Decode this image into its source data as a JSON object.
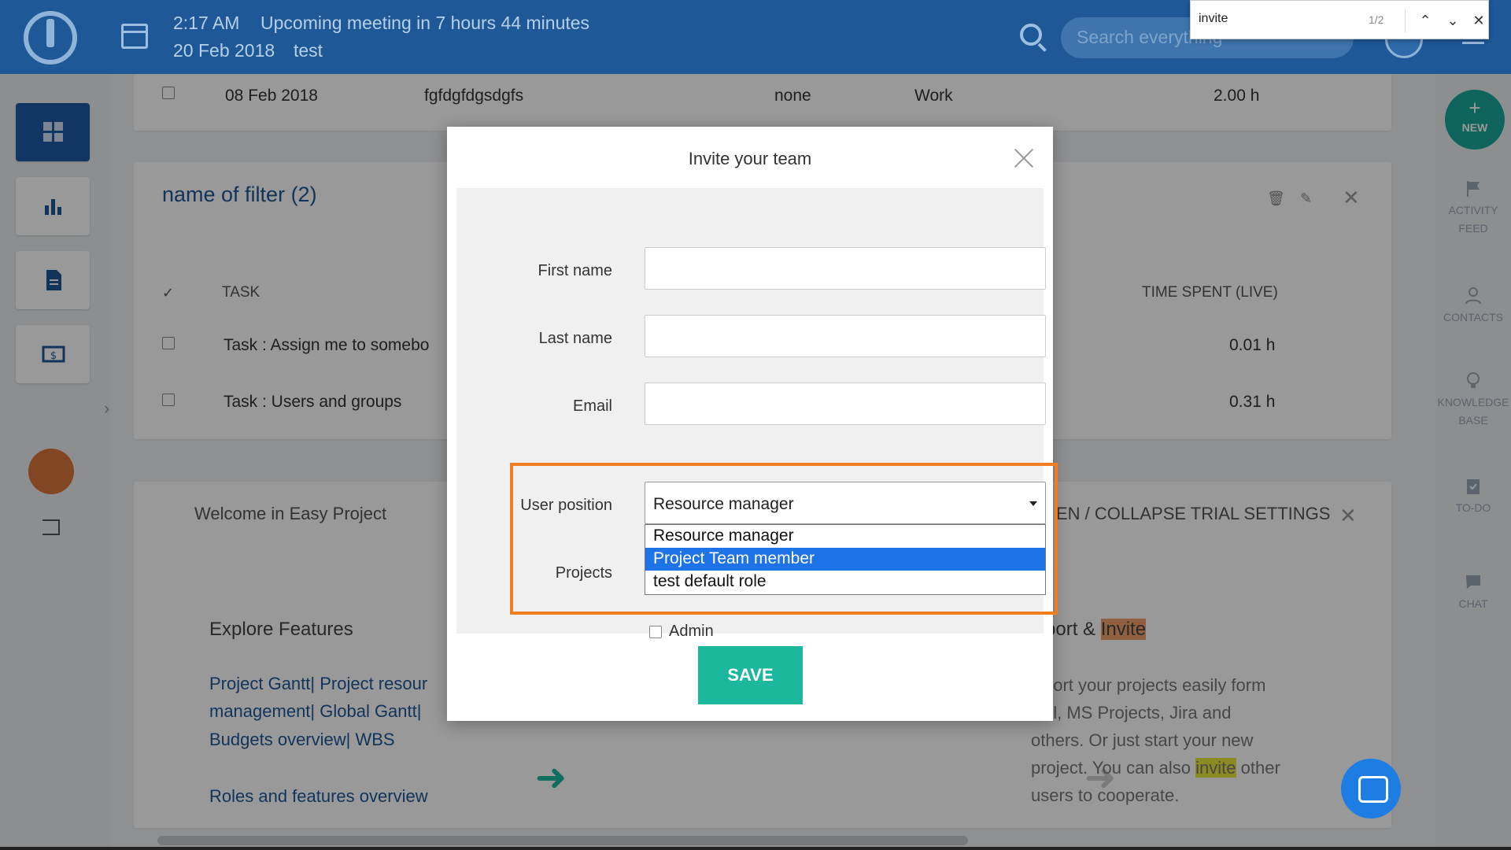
{
  "topbar": {
    "time": "2:17 AM",
    "upcoming": "Upcoming meeting in 7 hours 44 minutes",
    "date": "20 Feb 2018",
    "meeting_name": "test",
    "search_placeholder": "Search everything"
  },
  "findbar": {
    "query": "invite",
    "count": "1/2",
    "prev": "⌃",
    "next": "⌄",
    "close": "✕"
  },
  "background": {
    "top_row": {
      "date": "08 Feb 2018",
      "subject": "fgfdgfdgsdgfs",
      "status": "none",
      "activity": "Work",
      "hours": "2.00 h"
    },
    "filter_title": "name of filter (2)",
    "table_header_task": "TASK",
    "table_header_time": "TIME SPENT (LIVE)",
    "rows": [
      {
        "task": "Task : Assign me to somebo",
        "hours": "0.01 h"
      },
      {
        "task": "Task : Users and groups",
        "hours": "0.31 h"
      }
    ],
    "welcome": "Welcome in Easy Project",
    "trial_settings": "EN / COLLAPSE TRIAL SETTINGS",
    "explore_title": "Explore Features",
    "explore_links": "Project Gantt| Project resour",
    "explore_links2": "management| Global Gantt|",
    "explore_links3": "Budgets overview| WBS",
    "roles_link": "Roles and features overview",
    "import_title_pre": "port & ",
    "import_title_hl": "Invite",
    "import_text1": "port your projects easily form",
    "import_text2": "el, MS Projects, Jira and",
    "import_text3": "others. Or just start your new",
    "import_text4_pre": "project. You can also ",
    "import_text4_hl": "invite",
    "import_text4_post": " other",
    "import_text5": "users to cooperate."
  },
  "rightbar": {
    "new": "NEW",
    "activity_feed_1": "ACTIVITY",
    "activity_feed_2": "FEED",
    "contacts": "CONTACTS",
    "kb_1": "KNOWLEDGE",
    "kb_2": "BASE",
    "todo": "TO-DO",
    "chat": "CHAT"
  },
  "modal": {
    "title": "Invite your team",
    "first_name_label": "First name",
    "last_name_label": "Last name",
    "email_label": "Email",
    "user_position_label": "User position",
    "projects_label": "Projects",
    "user_position_value": "Resource manager",
    "options": [
      "Resource manager",
      "Project Team member",
      "test default role"
    ],
    "admin_label": "Admin",
    "save_label": "SAVE"
  },
  "colors": {
    "topbar": "#1e5896",
    "accent": "#1cb89e",
    "highlight_border": "#f07d1e",
    "selected_option": "#1e73e8"
  }
}
